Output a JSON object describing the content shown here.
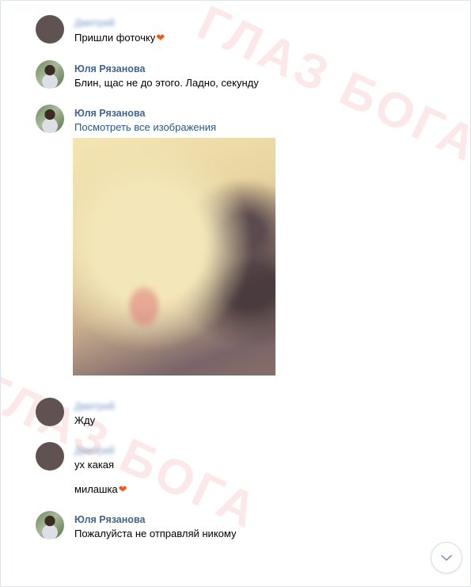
{
  "messages": [
    {
      "sender": "Дмитрий",
      "text": "Пришли фоточку",
      "heart": "❤"
    },
    {
      "sender": "Юля Рязанова",
      "text": "Блин, щас не до этого. Ладно, секунду"
    },
    {
      "sender": "Юля Рязанова",
      "link": "Посмотреть все изображения",
      "image": "blurred-photo"
    },
    {
      "sender": "Дмитрий",
      "text": "Жду"
    },
    {
      "sender": "Дмитрий",
      "text": "ух какая",
      "text2": "милашка",
      "heart": "❤"
    },
    {
      "sender": "Юля Рязанова",
      "text": "Пожалуйста не отправляй никому"
    }
  ],
  "watermark": "ГЛАЗ БОГА",
  "scroll_button": {
    "icon": "chevron-down-icon"
  },
  "colors": {
    "sender_name": "#42648b",
    "link": "#2a5885",
    "watermark": "#e85050",
    "heart": "#e85d1c"
  }
}
